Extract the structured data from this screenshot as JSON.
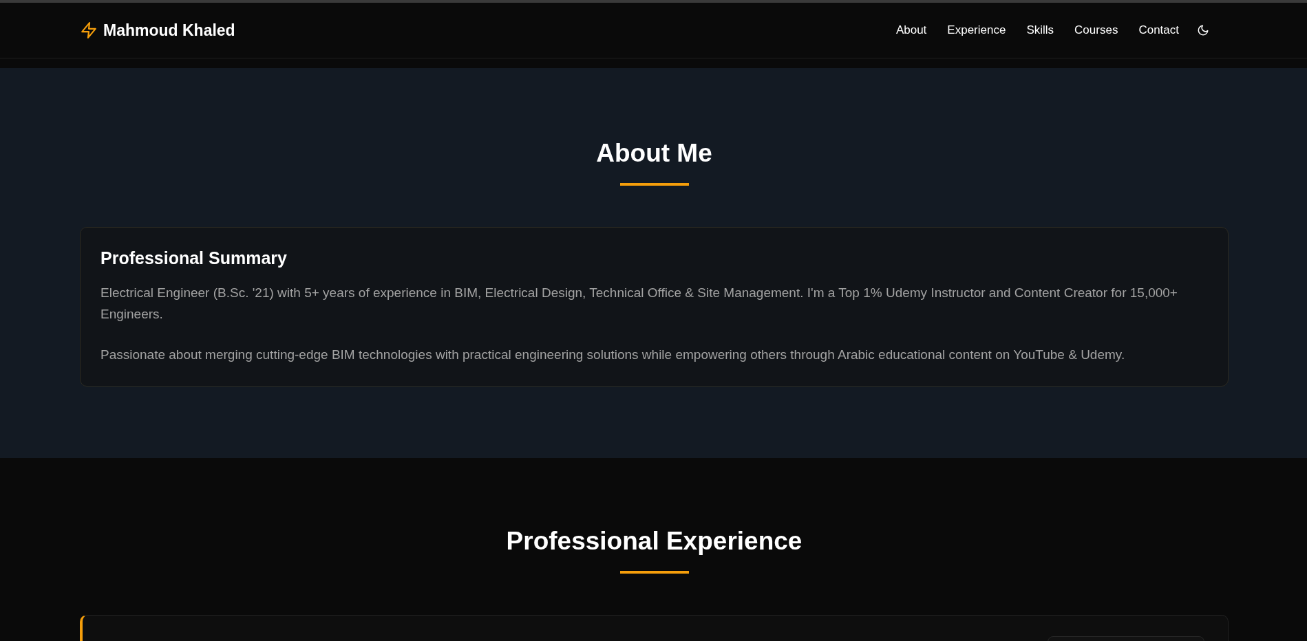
{
  "header": {
    "brand": "Mahmoud Khaled",
    "nav": [
      {
        "label": "About"
      },
      {
        "label": "Experience"
      },
      {
        "label": "Skills"
      },
      {
        "label": "Courses"
      },
      {
        "label": "Contact"
      }
    ]
  },
  "about": {
    "title": "About Me",
    "card": {
      "title": "Professional Summary",
      "paragraphs": [
        "Electrical Engineer (B.Sc. '21) with 5+ years of experience in BIM, Electrical Design, Technical Office & Site Management. I'm a Top 1% Udemy Instructor and Content Creator for 15,000+ Engineers.",
        "Passionate about merging cutting-edge BIM technologies with practical engineering solutions while empowering others through Arabic educational content on YouTube & Udemy."
      ]
    }
  },
  "experience": {
    "title": "Professional Experience"
  }
}
